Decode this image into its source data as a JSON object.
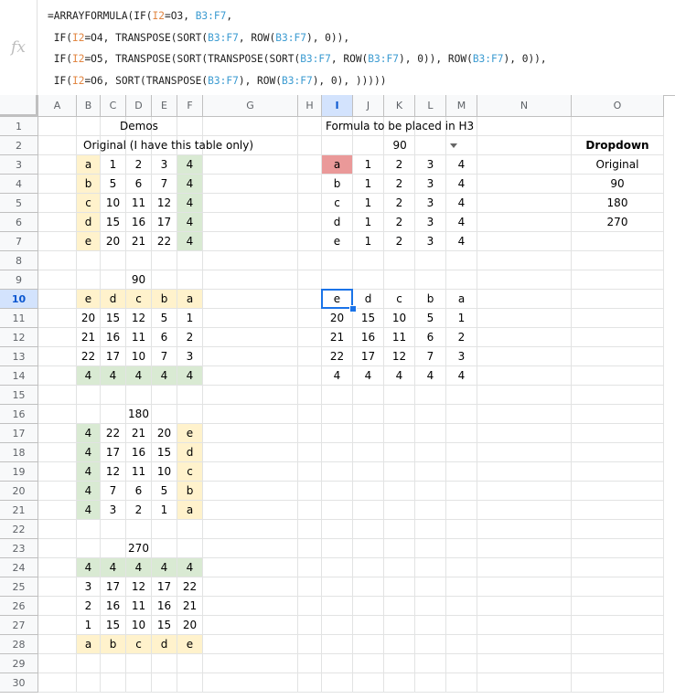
{
  "formula": {
    "fx_label": "fx",
    "lines": [
      [
        {
          "t": "=ARRAYFORMULA(IF(",
          "c": "op"
        },
        {
          "t": "I2",
          "c": "rc"
        },
        {
          "t": "=O3, ",
          "c": "op"
        },
        {
          "t": "B3:F7",
          "c": "rb"
        },
        {
          "t": ",",
          "c": "op"
        }
      ],
      [
        {
          "t": " IF(",
          "c": "op"
        },
        {
          "t": "I2",
          "c": "rc"
        },
        {
          "t": "=O4, TRANSPOSE(SORT(",
          "c": "op"
        },
        {
          "t": "B3:F7",
          "c": "rb"
        },
        {
          "t": ", ROW(",
          "c": "op"
        },
        {
          "t": "B3:F7",
          "c": "rb"
        },
        {
          "t": "), 0)),",
          "c": "op"
        }
      ],
      [
        {
          "t": " IF(",
          "c": "op"
        },
        {
          "t": "I2",
          "c": "rc"
        },
        {
          "t": "=O5, TRANSPOSE(SORT(TRANSPOSE(SORT(",
          "c": "op"
        },
        {
          "t": "B3:F7",
          "c": "rb"
        },
        {
          "t": ", ROW(",
          "c": "op"
        },
        {
          "t": "B3:F7",
          "c": "rb"
        },
        {
          "t": "), 0)), ROW(",
          "c": "op"
        },
        {
          "t": "B3:F7",
          "c": "rb"
        },
        {
          "t": "), 0)),",
          "c": "op"
        }
      ],
      [
        {
          "t": " IF(",
          "c": "op"
        },
        {
          "t": "I2",
          "c": "rc"
        },
        {
          "t": "=O6, SORT(TRANSPOSE(",
          "c": "op"
        },
        {
          "t": "B3:F7",
          "c": "rb"
        },
        {
          "t": "), ROW(",
          "c": "op"
        },
        {
          "t": "B3:F7",
          "c": "rb"
        },
        {
          "t": "), 0), )))))",
          "c": "op"
        }
      ]
    ]
  },
  "columns": [
    "A",
    "B",
    "C",
    "D",
    "E",
    "F",
    "G",
    "H",
    "I",
    "J",
    "K",
    "L",
    "M",
    "N",
    "O"
  ],
  "selected": {
    "col": "I",
    "row": 10
  },
  "colors": {
    "yellow": "#fff2cc",
    "green": "#d9ead3",
    "red": "#ea9999",
    "active_border": "#1a73e8"
  },
  "rows": [
    {
      "n": 1,
      "cells": []
    },
    {
      "n": 2,
      "cells": [
        {
          "col": "O",
          "v": "Dropdown",
          "bold": true
        }
      ]
    },
    {
      "n": 3,
      "cells": [
        {
          "col": "B",
          "v": "a",
          "fill": "yellow"
        },
        {
          "col": "C",
          "v": "1"
        },
        {
          "col": "D",
          "v": "2"
        },
        {
          "col": "E",
          "v": "3"
        },
        {
          "col": "F",
          "v": "4",
          "fill": "green"
        },
        {
          "col": "I",
          "v": "a",
          "fill": "red"
        },
        {
          "col": "J",
          "v": "1"
        },
        {
          "col": "K",
          "v": "2"
        },
        {
          "col": "L",
          "v": "3"
        },
        {
          "col": "M",
          "v": "4"
        },
        {
          "col": "O",
          "v": "Original"
        }
      ]
    },
    {
      "n": 4,
      "cells": [
        {
          "col": "B",
          "v": "b",
          "fill": "yellow"
        },
        {
          "col": "C",
          "v": "5"
        },
        {
          "col": "D",
          "v": "6"
        },
        {
          "col": "E",
          "v": "7"
        },
        {
          "col": "F",
          "v": "4",
          "fill": "green"
        },
        {
          "col": "I",
          "v": "b"
        },
        {
          "col": "J",
          "v": "1"
        },
        {
          "col": "K",
          "v": "2"
        },
        {
          "col": "L",
          "v": "3"
        },
        {
          "col": "M",
          "v": "4"
        },
        {
          "col": "O",
          "v": "90"
        }
      ]
    },
    {
      "n": 5,
      "cells": [
        {
          "col": "B",
          "v": "c",
          "fill": "yellow"
        },
        {
          "col": "C",
          "v": "10"
        },
        {
          "col": "D",
          "v": "11"
        },
        {
          "col": "E",
          "v": "12"
        },
        {
          "col": "F",
          "v": "4",
          "fill": "green"
        },
        {
          "col": "I",
          "v": "c"
        },
        {
          "col": "J",
          "v": "1"
        },
        {
          "col": "K",
          "v": "2"
        },
        {
          "col": "L",
          "v": "3"
        },
        {
          "col": "M",
          "v": "4"
        },
        {
          "col": "O",
          "v": "180"
        }
      ]
    },
    {
      "n": 6,
      "cells": [
        {
          "col": "B",
          "v": "d",
          "fill": "yellow"
        },
        {
          "col": "C",
          "v": "15"
        },
        {
          "col": "D",
          "v": "16"
        },
        {
          "col": "E",
          "v": "17"
        },
        {
          "col": "F",
          "v": "4",
          "fill": "green"
        },
        {
          "col": "I",
          "v": "d"
        },
        {
          "col": "J",
          "v": "1"
        },
        {
          "col": "K",
          "v": "2"
        },
        {
          "col": "L",
          "v": "3"
        },
        {
          "col": "M",
          "v": "4"
        },
        {
          "col": "O",
          "v": "270"
        }
      ]
    },
    {
      "n": 7,
      "cells": [
        {
          "col": "B",
          "v": "e",
          "fill": "yellow"
        },
        {
          "col": "C",
          "v": "20"
        },
        {
          "col": "D",
          "v": "21"
        },
        {
          "col": "E",
          "v": "22"
        },
        {
          "col": "F",
          "v": "4",
          "fill": "green"
        },
        {
          "col": "I",
          "v": "e"
        },
        {
          "col": "J",
          "v": "1"
        },
        {
          "col": "K",
          "v": "2"
        },
        {
          "col": "L",
          "v": "3"
        },
        {
          "col": "M",
          "v": "4"
        }
      ]
    },
    {
      "n": 8,
      "cells": []
    },
    {
      "n": 9,
      "cells": [
        {
          "col": "D",
          "v": "90"
        }
      ]
    },
    {
      "n": 10,
      "cells": [
        {
          "col": "B",
          "v": "e",
          "fill": "yellow"
        },
        {
          "col": "C",
          "v": "d",
          "fill": "yellow"
        },
        {
          "col": "D",
          "v": "c",
          "fill": "yellow"
        },
        {
          "col": "E",
          "v": "b",
          "fill": "yellow"
        },
        {
          "col": "F",
          "v": "a",
          "fill": "yellow"
        },
        {
          "col": "I",
          "v": "e"
        },
        {
          "col": "J",
          "v": "d"
        },
        {
          "col": "K",
          "v": "c"
        },
        {
          "col": "L",
          "v": "b"
        },
        {
          "col": "M",
          "v": "a"
        }
      ]
    },
    {
      "n": 11,
      "cells": [
        {
          "col": "B",
          "v": "20"
        },
        {
          "col": "C",
          "v": "15"
        },
        {
          "col": "D",
          "v": "12"
        },
        {
          "col": "E",
          "v": "5"
        },
        {
          "col": "F",
          "v": "1"
        },
        {
          "col": "I",
          "v": "20"
        },
        {
          "col": "J",
          "v": "15"
        },
        {
          "col": "K",
          "v": "10"
        },
        {
          "col": "L",
          "v": "5"
        },
        {
          "col": "M",
          "v": "1"
        }
      ]
    },
    {
      "n": 12,
      "cells": [
        {
          "col": "B",
          "v": "21"
        },
        {
          "col": "C",
          "v": "16"
        },
        {
          "col": "D",
          "v": "11"
        },
        {
          "col": "E",
          "v": "6"
        },
        {
          "col": "F",
          "v": "2"
        },
        {
          "col": "I",
          "v": "21"
        },
        {
          "col": "J",
          "v": "16"
        },
        {
          "col": "K",
          "v": "11"
        },
        {
          "col": "L",
          "v": "6"
        },
        {
          "col": "M",
          "v": "2"
        }
      ]
    },
    {
      "n": 13,
      "cells": [
        {
          "col": "B",
          "v": "22"
        },
        {
          "col": "C",
          "v": "17"
        },
        {
          "col": "D",
          "v": "10"
        },
        {
          "col": "E",
          "v": "7"
        },
        {
          "col": "F",
          "v": "3"
        },
        {
          "col": "I",
          "v": "22"
        },
        {
          "col": "J",
          "v": "17"
        },
        {
          "col": "K",
          "v": "12"
        },
        {
          "col": "L",
          "v": "7"
        },
        {
          "col": "M",
          "v": "3"
        }
      ]
    },
    {
      "n": 14,
      "cells": [
        {
          "col": "B",
          "v": "4",
          "fill": "green"
        },
        {
          "col": "C",
          "v": "4",
          "fill": "green"
        },
        {
          "col": "D",
          "v": "4",
          "fill": "green"
        },
        {
          "col": "E",
          "v": "4",
          "fill": "green"
        },
        {
          "col": "F",
          "v": "4",
          "fill": "green"
        },
        {
          "col": "I",
          "v": "4"
        },
        {
          "col": "J",
          "v": "4"
        },
        {
          "col": "K",
          "v": "4"
        },
        {
          "col": "L",
          "v": "4"
        },
        {
          "col": "M",
          "v": "4"
        }
      ]
    },
    {
      "n": 15,
      "cells": []
    },
    {
      "n": 16,
      "cells": [
        {
          "col": "D",
          "v": "180"
        }
      ]
    },
    {
      "n": 17,
      "cells": [
        {
          "col": "B",
          "v": "4",
          "fill": "green"
        },
        {
          "col": "C",
          "v": "22"
        },
        {
          "col": "D",
          "v": "21"
        },
        {
          "col": "E",
          "v": "20"
        },
        {
          "col": "F",
          "v": "e",
          "fill": "yellow"
        }
      ]
    },
    {
      "n": 18,
      "cells": [
        {
          "col": "B",
          "v": "4",
          "fill": "green"
        },
        {
          "col": "C",
          "v": "17"
        },
        {
          "col": "D",
          "v": "16"
        },
        {
          "col": "E",
          "v": "15"
        },
        {
          "col": "F",
          "v": "d",
          "fill": "yellow"
        }
      ]
    },
    {
      "n": 19,
      "cells": [
        {
          "col": "B",
          "v": "4",
          "fill": "green"
        },
        {
          "col": "C",
          "v": "12"
        },
        {
          "col": "D",
          "v": "11"
        },
        {
          "col": "E",
          "v": "10"
        },
        {
          "col": "F",
          "v": "c",
          "fill": "yellow"
        }
      ]
    },
    {
      "n": 20,
      "cells": [
        {
          "col": "B",
          "v": "4",
          "fill": "green"
        },
        {
          "col": "C",
          "v": "7"
        },
        {
          "col": "D",
          "v": "6"
        },
        {
          "col": "E",
          "v": "5"
        },
        {
          "col": "F",
          "v": "b",
          "fill": "yellow"
        }
      ]
    },
    {
      "n": 21,
      "cells": [
        {
          "col": "B",
          "v": "4",
          "fill": "green"
        },
        {
          "col": "C",
          "v": "3"
        },
        {
          "col": "D",
          "v": "2"
        },
        {
          "col": "E",
          "v": "1"
        },
        {
          "col": "F",
          "v": "a",
          "fill": "yellow"
        }
      ]
    },
    {
      "n": 22,
      "cells": []
    },
    {
      "n": 23,
      "cells": [
        {
          "col": "D",
          "v": "270"
        }
      ]
    },
    {
      "n": 24,
      "cells": [
        {
          "col": "B",
          "v": "4",
          "fill": "green"
        },
        {
          "col": "C",
          "v": "4",
          "fill": "green"
        },
        {
          "col": "D",
          "v": "4",
          "fill": "green"
        },
        {
          "col": "E",
          "v": "4",
          "fill": "green"
        },
        {
          "col": "F",
          "v": "4",
          "fill": "green"
        }
      ]
    },
    {
      "n": 25,
      "cells": [
        {
          "col": "B",
          "v": "3"
        },
        {
          "col": "C",
          "v": "17"
        },
        {
          "col": "D",
          "v": "12"
        },
        {
          "col": "E",
          "v": "17"
        },
        {
          "col": "F",
          "v": "22"
        }
      ]
    },
    {
      "n": 26,
      "cells": [
        {
          "col": "B",
          "v": "2"
        },
        {
          "col": "C",
          "v": "16"
        },
        {
          "col": "D",
          "v": "11"
        },
        {
          "col": "E",
          "v": "16"
        },
        {
          "col": "F",
          "v": "21"
        }
      ]
    },
    {
      "n": 27,
      "cells": [
        {
          "col": "B",
          "v": "1"
        },
        {
          "col": "C",
          "v": "15"
        },
        {
          "col": "D",
          "v": "10"
        },
        {
          "col": "E",
          "v": "15"
        },
        {
          "col": "F",
          "v": "20"
        }
      ]
    },
    {
      "n": 28,
      "cells": [
        {
          "col": "B",
          "v": "a",
          "fill": "yellow"
        },
        {
          "col": "C",
          "v": "b",
          "fill": "yellow"
        },
        {
          "col": "D",
          "v": "c",
          "fill": "yellow"
        },
        {
          "col": "E",
          "v": "d",
          "fill": "yellow"
        },
        {
          "col": "F",
          "v": "e",
          "fill": "yellow"
        }
      ]
    },
    {
      "n": 29,
      "cells": []
    },
    {
      "n": 30,
      "cells": []
    }
  ],
  "overlays": {
    "demos_title": "Demos",
    "original_label": "Original (I have this table only)",
    "formula_note": "Formula to be placed in H3",
    "dropdown_value": "90"
  }
}
